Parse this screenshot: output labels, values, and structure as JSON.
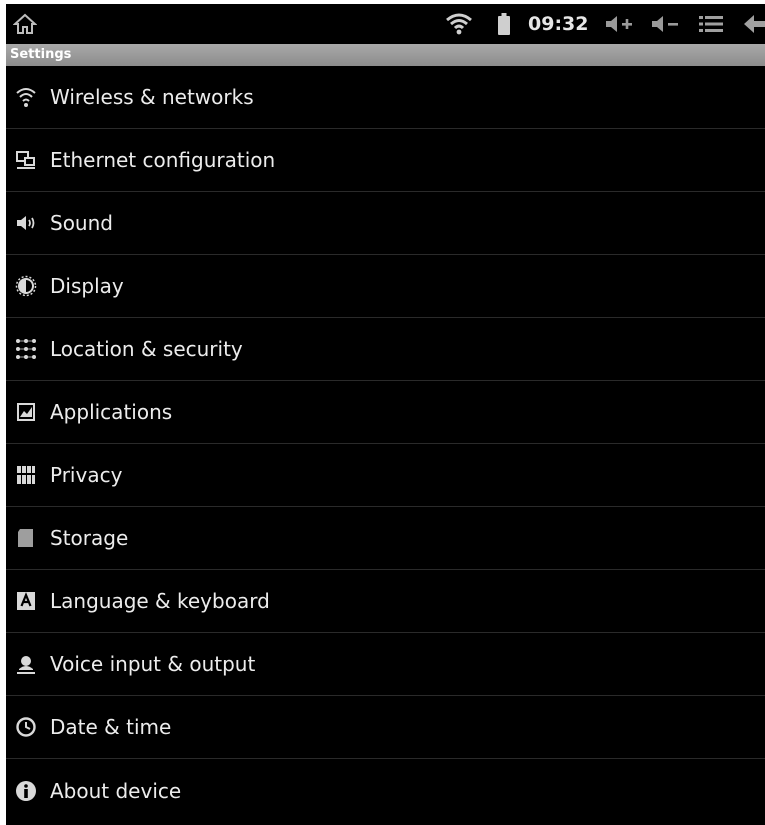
{
  "status_bar": {
    "time": "09:32",
    "icons": [
      "home-icon",
      "wifi-icon",
      "battery-icon",
      "volume-up-icon",
      "volume-down-icon",
      "menu-icon",
      "back-icon"
    ]
  },
  "title_bar": {
    "title": "Settings"
  },
  "settings": {
    "items": [
      {
        "label": "Wireless & networks",
        "icon": "wifi-icon"
      },
      {
        "label": "Ethernet configuration",
        "icon": "ethernet-icon"
      },
      {
        "label": "Sound",
        "icon": "speaker-icon"
      },
      {
        "label": "Display",
        "icon": "brightness-icon"
      },
      {
        "label": "Location & security",
        "icon": "location-grid-icon"
      },
      {
        "label": "Applications",
        "icon": "applications-icon"
      },
      {
        "label": "Privacy",
        "icon": "privacy-icon"
      },
      {
        "label": "Storage",
        "icon": "sd-card-icon"
      },
      {
        "label": "Language & keyboard",
        "icon": "keyboard-a-icon"
      },
      {
        "label": "Voice input & output",
        "icon": "voice-icon"
      },
      {
        "label": "Date & time",
        "icon": "clock-icon"
      },
      {
        "label": "About device",
        "icon": "info-icon"
      }
    ]
  },
  "colors": {
    "background": "#000000",
    "title_bar": "#9a9a9a",
    "text": "#ececec",
    "divider": "#2a2a2a"
  }
}
